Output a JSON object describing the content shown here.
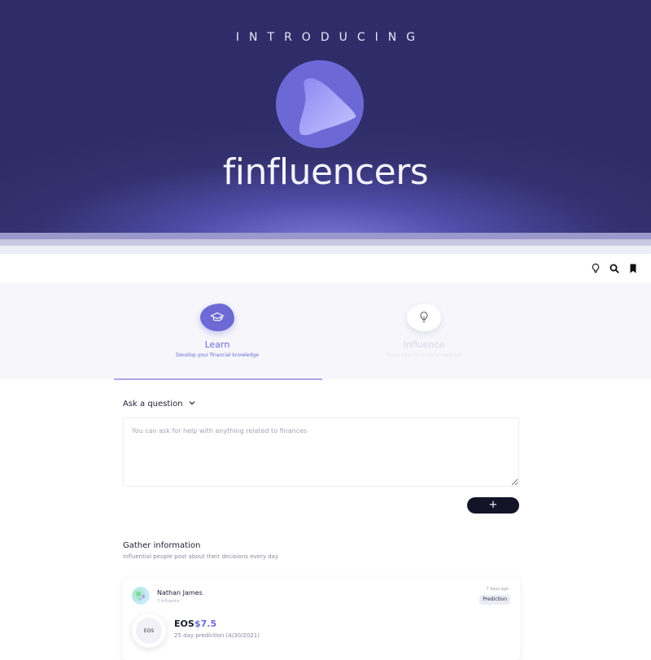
{
  "hero": {
    "kicker": "INTRODUCING",
    "wordmark": "finfluencers",
    "logo_icon": "finfluencers-logo"
  },
  "topbar": {
    "icons": [
      "lightbulb-icon",
      "search-icon",
      "bookmark-icon"
    ]
  },
  "modes": {
    "learn": {
      "title": "Learn",
      "subtitle": "Develop your financial knowledge",
      "icon": "graduation-cap-icon",
      "active": true
    },
    "influence": {
      "title": "Influence",
      "subtitle": "Share your financial knowledge",
      "icon": "lightbulb-icon",
      "active": false
    }
  },
  "ask": {
    "label": "Ask a question",
    "placeholder": "You can ask for help with anything related to finances",
    "value": "",
    "submit_label": "+"
  },
  "gather": {
    "title": "Gather information",
    "subtitle": "Influential people post about their decisions every day"
  },
  "post": {
    "author": "Nathan James",
    "author_meta": "2 influence",
    "time_ago": "7 days ago",
    "badge": "Prediction",
    "coin_label": "EOS",
    "ticker": "EOS",
    "price": "$7.5",
    "note": "25 day prediction (4/30/2021)"
  },
  "colors": {
    "hero_bg": "#2f2d69",
    "accent": "#6d6ad6",
    "button_dark": "#141428"
  }
}
